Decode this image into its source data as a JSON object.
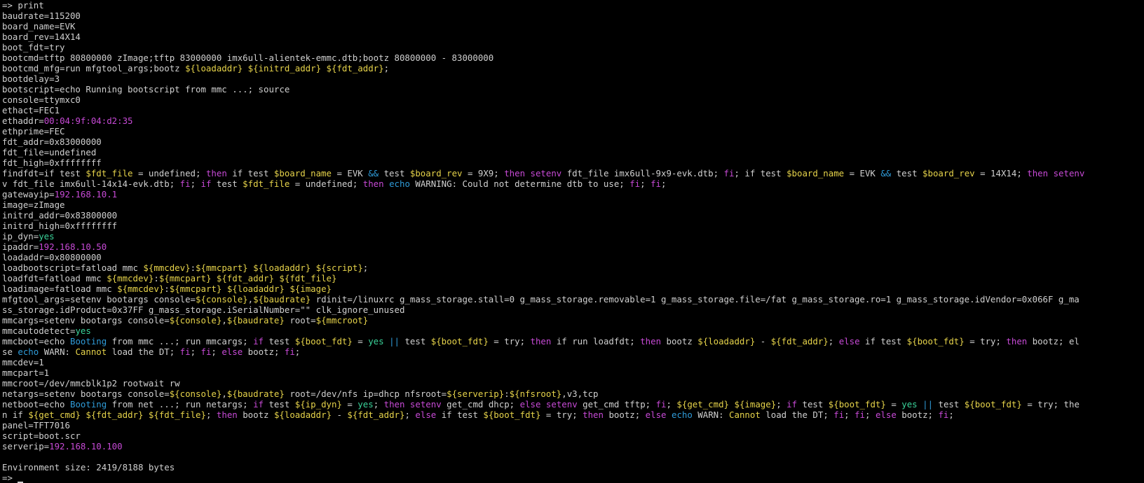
{
  "terminal": {
    "background": "#000000",
    "colors": {
      "default": "#d0d0d0",
      "purple": "#c74ad6",
      "yellow": "#e6d34a",
      "green": "#3ad39a",
      "blue": "#2f9bd8"
    },
    "lines": [
      [
        [
          "default",
          "=> print"
        ]
      ],
      [
        [
          "default",
          "baudrate=115200"
        ]
      ],
      [
        [
          "default",
          "board_name=EVK"
        ]
      ],
      [
        [
          "default",
          "board_rev=14X14"
        ]
      ],
      [
        [
          "default",
          "boot_fdt=try"
        ]
      ],
      [
        [
          "default",
          "bootcmd=tftp 80800000 zImage;tftp 83000000 imx6ull-alientek-emmc.dtb;bootz 80800000 - 83000000"
        ]
      ],
      [
        [
          "default",
          "bootcmd_mfg=run mfgtool_args;bootz "
        ],
        [
          "yellow",
          "${loadaddr}"
        ],
        [
          "default",
          " "
        ],
        [
          "yellow",
          "${initrd_addr}"
        ],
        [
          "default",
          " "
        ],
        [
          "yellow",
          "${fdt_addr}"
        ],
        [
          "default",
          ";"
        ]
      ],
      [
        [
          "default",
          "bootdelay=3"
        ]
      ],
      [
        [
          "default",
          "bootscript=echo Running bootscript from mmc ...; source"
        ]
      ],
      [
        [
          "default",
          "console=ttymxc0"
        ]
      ],
      [
        [
          "default",
          "ethact=FEC1"
        ]
      ],
      [
        [
          "default",
          "ethaddr="
        ],
        [
          "purple",
          "00:04:9f:04:d2:35"
        ]
      ],
      [
        [
          "default",
          "ethprime=FEC"
        ]
      ],
      [
        [
          "default",
          "fdt_addr=0x83000000"
        ]
      ],
      [
        [
          "default",
          "fdt_file=undefined"
        ]
      ],
      [
        [
          "default",
          "fdt_high=0xffffffff"
        ]
      ],
      [
        [
          "default",
          "findfdt=if test "
        ],
        [
          "yellow",
          "$fdt_file"
        ],
        [
          "default",
          " = undefined; "
        ],
        [
          "purple",
          "then"
        ],
        [
          "default",
          " if test "
        ],
        [
          "yellow",
          "$board_name"
        ],
        [
          "default",
          " = EVK "
        ],
        [
          "blue",
          "&&"
        ],
        [
          "default",
          " test "
        ],
        [
          "yellow",
          "$board_rev"
        ],
        [
          "default",
          " = 9X9; "
        ],
        [
          "purple",
          "then"
        ],
        [
          "default",
          " "
        ],
        [
          "purple",
          "setenv"
        ],
        [
          "default",
          " fdt_file imx6ull-9x9-evk.dtb; "
        ],
        [
          "purple",
          "fi"
        ],
        [
          "default",
          "; if test "
        ],
        [
          "yellow",
          "$board_name"
        ],
        [
          "default",
          " = EVK "
        ],
        [
          "blue",
          "&&"
        ],
        [
          "default",
          " test "
        ],
        [
          "yellow",
          "$board_rev"
        ],
        [
          "default",
          " = 14X14; "
        ],
        [
          "purple",
          "then"
        ],
        [
          "default",
          " "
        ],
        [
          "purple",
          "setenv"
        ]
      ],
      [
        [
          "default",
          "v fdt_file imx6ull-14x14-evk.dtb; "
        ],
        [
          "purple",
          "fi"
        ],
        [
          "default",
          "; "
        ],
        [
          "purple",
          "if"
        ],
        [
          "default",
          " test "
        ],
        [
          "yellow",
          "$fdt_file"
        ],
        [
          "default",
          " = undefined; "
        ],
        [
          "purple",
          "then"
        ],
        [
          "default",
          " "
        ],
        [
          "blue",
          "echo"
        ],
        [
          "default",
          " WARNING: Could not determine dtb to use; "
        ],
        [
          "purple",
          "fi"
        ],
        [
          "default",
          "; "
        ],
        [
          "purple",
          "fi"
        ],
        [
          "default",
          ";"
        ]
      ],
      [
        [
          "default",
          "gatewayip="
        ],
        [
          "purple",
          "192.168.10.1"
        ]
      ],
      [
        [
          "default",
          "image=zImage"
        ]
      ],
      [
        [
          "default",
          "initrd_addr=0x83800000"
        ]
      ],
      [
        [
          "default",
          "initrd_high=0xffffffff"
        ]
      ],
      [
        [
          "default",
          "ip_dyn="
        ],
        [
          "green",
          "yes"
        ]
      ],
      [
        [
          "default",
          "ipaddr="
        ],
        [
          "purple",
          "192.168.10.50"
        ]
      ],
      [
        [
          "default",
          "loadaddr=0x80800000"
        ]
      ],
      [
        [
          "default",
          "loadbootscript=fatload mmc "
        ],
        [
          "yellow",
          "${mmcdev}"
        ],
        [
          "default",
          ":"
        ],
        [
          "yellow",
          "${mmcpart}"
        ],
        [
          "default",
          " "
        ],
        [
          "yellow",
          "${loadaddr}"
        ],
        [
          "default",
          " "
        ],
        [
          "yellow",
          "${script}"
        ],
        [
          "default",
          ";"
        ]
      ],
      [
        [
          "default",
          "loadfdt=fatload mmc "
        ],
        [
          "yellow",
          "${mmcdev}"
        ],
        [
          "default",
          ":"
        ],
        [
          "yellow",
          "${mmcpart}"
        ],
        [
          "default",
          " "
        ],
        [
          "yellow",
          "${fdt_addr}"
        ],
        [
          "default",
          " "
        ],
        [
          "yellow",
          "${fdt_file}"
        ]
      ],
      [
        [
          "default",
          "loadimage=fatload mmc "
        ],
        [
          "yellow",
          "${mmcdev}"
        ],
        [
          "default",
          ":"
        ],
        [
          "yellow",
          "${mmcpart}"
        ],
        [
          "default",
          " "
        ],
        [
          "yellow",
          "${loadaddr}"
        ],
        [
          "default",
          " "
        ],
        [
          "yellow",
          "${image}"
        ]
      ],
      [
        [
          "default",
          "mfgtool_args=setenv bootargs console="
        ],
        [
          "yellow",
          "${console}"
        ],
        [
          "default",
          ","
        ],
        [
          "yellow",
          "${baudrate}"
        ],
        [
          "default",
          " rdinit=/linuxrc g_mass_storage.stall=0 g_mass_storage.removable=1 g_mass_storage.file=/fat g_mass_storage.ro=1 g_mass_storage.idVendor=0x066F g_ma"
        ]
      ],
      [
        [
          "default",
          "ss_storage.idProduct=0x37FF g_mass_storage.iSerialNumber=\"\" clk_ignore_unused"
        ]
      ],
      [
        [
          "default",
          "mmcargs=setenv bootargs console="
        ],
        [
          "yellow",
          "${console}"
        ],
        [
          "default",
          ","
        ],
        [
          "yellow",
          "${baudrate}"
        ],
        [
          "default",
          " root="
        ],
        [
          "yellow",
          "${mmcroot}"
        ]
      ],
      [
        [
          "default",
          "mmcautodetect="
        ],
        [
          "green",
          "yes"
        ]
      ],
      [
        [
          "default",
          "mmcboot=echo "
        ],
        [
          "blue",
          "Booting"
        ],
        [
          "default",
          " from mmc ...; run mmcargs; "
        ],
        [
          "purple",
          "if"
        ],
        [
          "default",
          " test "
        ],
        [
          "yellow",
          "${boot_fdt}"
        ],
        [
          "default",
          " = "
        ],
        [
          "green",
          "yes"
        ],
        [
          "default",
          " "
        ],
        [
          "blue",
          "||"
        ],
        [
          "default",
          " test "
        ],
        [
          "yellow",
          "${boot_fdt}"
        ],
        [
          "default",
          " = try; "
        ],
        [
          "purple",
          "then"
        ],
        [
          "default",
          " if run loadfdt; "
        ],
        [
          "purple",
          "then"
        ],
        [
          "default",
          " bootz "
        ],
        [
          "yellow",
          "${loadaddr}"
        ],
        [
          "default",
          " - "
        ],
        [
          "yellow",
          "${fdt_addr}"
        ],
        [
          "default",
          "; "
        ],
        [
          "purple",
          "else"
        ],
        [
          "default",
          " if test "
        ],
        [
          "yellow",
          "${boot_fdt}"
        ],
        [
          "default",
          " = try; "
        ],
        [
          "purple",
          "then"
        ],
        [
          "default",
          " bootz; el"
        ]
      ],
      [
        [
          "default",
          "se "
        ],
        [
          "blue",
          "echo"
        ],
        [
          "default",
          " WARN: "
        ],
        [
          "yellow",
          "Cannot"
        ],
        [
          "default",
          " load the DT; "
        ],
        [
          "purple",
          "fi"
        ],
        [
          "default",
          "; "
        ],
        [
          "purple",
          "fi"
        ],
        [
          "default",
          "; "
        ],
        [
          "purple",
          "else"
        ],
        [
          "default",
          " bootz; "
        ],
        [
          "purple",
          "fi"
        ],
        [
          "default",
          ";"
        ]
      ],
      [
        [
          "default",
          "mmcdev=1"
        ]
      ],
      [
        [
          "default",
          "mmcpart=1"
        ]
      ],
      [
        [
          "default",
          "mmcroot=/dev/mmcblk1p2 rootwait rw"
        ]
      ],
      [
        [
          "default",
          "netargs=setenv bootargs console="
        ],
        [
          "yellow",
          "${console}"
        ],
        [
          "default",
          ","
        ],
        [
          "yellow",
          "${baudrate}"
        ],
        [
          "default",
          " root=/dev/nfs ip=dhcp nfsroot="
        ],
        [
          "yellow",
          "${serverip}"
        ],
        [
          "default",
          ":"
        ],
        [
          "yellow",
          "${nfsroot}"
        ],
        [
          "default",
          ",v3,tcp"
        ]
      ],
      [
        [
          "default",
          "netboot=echo "
        ],
        [
          "blue",
          "Booting"
        ],
        [
          "default",
          " from net ...; run netargs; "
        ],
        [
          "purple",
          "if"
        ],
        [
          "default",
          " test "
        ],
        [
          "yellow",
          "${ip_dyn}"
        ],
        [
          "default",
          " = "
        ],
        [
          "green",
          "yes"
        ],
        [
          "default",
          "; "
        ],
        [
          "purple",
          "then"
        ],
        [
          "default",
          " "
        ],
        [
          "purple",
          "setenv"
        ],
        [
          "default",
          " get_cmd dhcp; "
        ],
        [
          "purple",
          "else"
        ],
        [
          "default",
          " "
        ],
        [
          "purple",
          "setenv"
        ],
        [
          "default",
          " get_cmd tftp; "
        ],
        [
          "purple",
          "fi"
        ],
        [
          "default",
          "; "
        ],
        [
          "yellow",
          "${get_cmd}"
        ],
        [
          "default",
          " "
        ],
        [
          "yellow",
          "${image}"
        ],
        [
          "default",
          "; "
        ],
        [
          "purple",
          "if"
        ],
        [
          "default",
          " test "
        ],
        [
          "yellow",
          "${boot_fdt}"
        ],
        [
          "default",
          " = "
        ],
        [
          "green",
          "yes"
        ],
        [
          "default",
          " "
        ],
        [
          "blue",
          "||"
        ],
        [
          "default",
          " test "
        ],
        [
          "yellow",
          "${boot_fdt}"
        ],
        [
          "default",
          " = try; the"
        ]
      ],
      [
        [
          "default",
          "n if "
        ],
        [
          "yellow",
          "${get_cmd}"
        ],
        [
          "default",
          " "
        ],
        [
          "yellow",
          "${fdt_addr}"
        ],
        [
          "default",
          " "
        ],
        [
          "yellow",
          "${fdt_file}"
        ],
        [
          "default",
          "; "
        ],
        [
          "purple",
          "then"
        ],
        [
          "default",
          " bootz "
        ],
        [
          "yellow",
          "${loadaddr}"
        ],
        [
          "default",
          " - "
        ],
        [
          "yellow",
          "${fdt_addr}"
        ],
        [
          "default",
          "; "
        ],
        [
          "purple",
          "else"
        ],
        [
          "default",
          " if test "
        ],
        [
          "yellow",
          "${boot_fdt}"
        ],
        [
          "default",
          " = try; "
        ],
        [
          "purple",
          "then"
        ],
        [
          "default",
          " bootz; "
        ],
        [
          "purple",
          "else"
        ],
        [
          "default",
          " "
        ],
        [
          "blue",
          "echo"
        ],
        [
          "default",
          " WARN: "
        ],
        [
          "yellow",
          "Cannot"
        ],
        [
          "default",
          " load the DT; "
        ],
        [
          "purple",
          "fi"
        ],
        [
          "default",
          "; "
        ],
        [
          "purple",
          "fi"
        ],
        [
          "default",
          "; "
        ],
        [
          "purple",
          "else"
        ],
        [
          "default",
          " bootz; "
        ],
        [
          "purple",
          "fi"
        ],
        [
          "default",
          ";"
        ]
      ],
      [
        [
          "default",
          "panel=TFT7016"
        ]
      ],
      [
        [
          "default",
          "script=boot.scr"
        ]
      ],
      [
        [
          "default",
          "serverip="
        ],
        [
          "purple",
          "192.168.10.100"
        ]
      ],
      [
        [
          "default",
          ""
        ]
      ],
      [
        [
          "default",
          "Environment size: 2419/8188 bytes"
        ]
      ],
      [
        [
          "default",
          "=> "
        ]
      ]
    ]
  }
}
